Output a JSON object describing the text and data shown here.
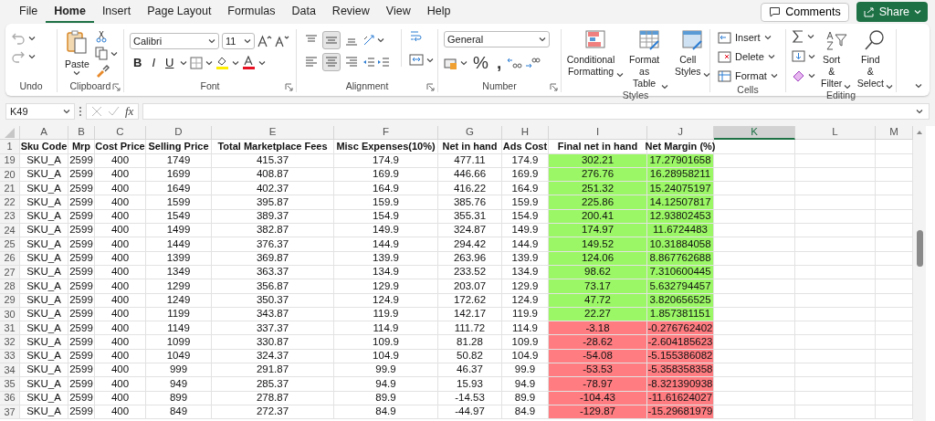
{
  "menu_tabs": [
    {
      "label": "File",
      "selected": false
    },
    {
      "label": "Home",
      "selected": true
    },
    {
      "label": "Insert",
      "selected": false
    },
    {
      "label": "Page Layout",
      "selected": false
    },
    {
      "label": "Formulas",
      "selected": false
    },
    {
      "label": "Data",
      "selected": false
    },
    {
      "label": "Review",
      "selected": false
    },
    {
      "label": "View",
      "selected": false
    },
    {
      "label": "Help",
      "selected": false
    }
  ],
  "top_buttons": {
    "comments": "Comments",
    "share": "Share"
  },
  "ribbon": {
    "groups": [
      {
        "kind": "undo",
        "label": "Undo"
      },
      {
        "kind": "clipboard",
        "label": "Clipboard",
        "launcher": true,
        "paste": "Paste"
      },
      {
        "kind": "font",
        "label": "Font",
        "launcher": true,
        "font_name": "Calibri",
        "font_size": "11",
        "style_buttons": [
          "B",
          "I",
          "U"
        ]
      },
      {
        "kind": "alignment",
        "label": "Alignment",
        "launcher": true,
        "vertical_align_buttons": [
          {
            "selected": false
          },
          {
            "selected": true
          },
          {
            "selected": false
          }
        ],
        "horizontal_align_buttons": [
          {
            "selected": false
          },
          {
            "selected": true
          },
          {
            "selected": false
          }
        ]
      },
      {
        "kind": "number",
        "label": "Number",
        "launcher": true,
        "format": "General",
        "symbol_buttons": [
          "%",
          ","
        ]
      },
      {
        "kind": "styles",
        "label": "Styles",
        "buttons": [
          "Conditional Formatting",
          "Format as Table",
          "Cell Styles"
        ]
      },
      {
        "kind": "cells",
        "label": "Cells",
        "buttons": [
          "Insert",
          "Delete",
          "Format"
        ]
      },
      {
        "kind": "editing",
        "label": "Editing",
        "buttons": [
          "Sort & Filter",
          "Find & Select"
        ]
      }
    ]
  },
  "formula_bar": {
    "name_box": "K49",
    "function_label": "fx"
  },
  "sheet": {
    "columns": [
      {
        "label": "A",
        "selected": false
      },
      {
        "label": "B",
        "selected": false
      },
      {
        "label": "C",
        "selected": false
      },
      {
        "label": "D",
        "selected": false
      },
      {
        "label": "E",
        "selected": false
      },
      {
        "label": "F",
        "selected": false
      },
      {
        "label": "G",
        "selected": false
      },
      {
        "label": "H",
        "selected": false
      },
      {
        "label": "I",
        "selected": false
      },
      {
        "label": "J",
        "selected": false
      },
      {
        "label": "K",
        "selected": true
      },
      {
        "label": "L",
        "selected": false
      },
      {
        "label": "M",
        "selected": false
      }
    ],
    "header_row": {
      "number": "1",
      "cells": [
        "Sku Code",
        "Mrp",
        "Cost Price",
        "Selling Price",
        "Total Marketplace Fees",
        "Misc Expenses(10%)",
        "Net in hand",
        "Ads Cost",
        "Final net in hand",
        "Net Margin (%)"
      ]
    },
    "rows": [
      {
        "number": "19",
        "color": "#9bf765",
        "cells": [
          "SKU_A",
          "2599",
          "400",
          "1749",
          "415.37",
          "174.9",
          "477.11",
          "174.9",
          "302.21",
          "17.27901658"
        ]
      },
      {
        "number": "20",
        "color": "#9bf765",
        "cells": [
          "SKU_A",
          "2599",
          "400",
          "1699",
          "408.87",
          "169.9",
          "446.66",
          "169.9",
          "276.76",
          "16.28958211"
        ]
      },
      {
        "number": "21",
        "color": "#9bf765",
        "cells": [
          "SKU_A",
          "2599",
          "400",
          "1649",
          "402.37",
          "164.9",
          "416.22",
          "164.9",
          "251.32",
          "15.24075197"
        ]
      },
      {
        "number": "22",
        "color": "#9bf765",
        "cells": [
          "SKU_A",
          "2599",
          "400",
          "1599",
          "395.87",
          "159.9",
          "385.76",
          "159.9",
          "225.86",
          "14.12507817"
        ]
      },
      {
        "number": "23",
        "color": "#9bf765",
        "cells": [
          "SKU_A",
          "2599",
          "400",
          "1549",
          "389.37",
          "154.9",
          "355.31",
          "154.9",
          "200.41",
          "12.93802453"
        ]
      },
      {
        "number": "24",
        "color": "#9bf765",
        "cells": [
          "SKU_A",
          "2599",
          "400",
          "1499",
          "382.87",
          "149.9",
          "324.87",
          "149.9",
          "174.97",
          "11.6724483"
        ]
      },
      {
        "number": "25",
        "color": "#9bf765",
        "cells": [
          "SKU_A",
          "2599",
          "400",
          "1449",
          "376.37",
          "144.9",
          "294.42",
          "144.9",
          "149.52",
          "10.31884058"
        ]
      },
      {
        "number": "26",
        "color": "#9bf765",
        "cells": [
          "SKU_A",
          "2599",
          "400",
          "1399",
          "369.87",
          "139.9",
          "263.96",
          "139.9",
          "124.06",
          "8.867762688"
        ]
      },
      {
        "number": "27",
        "color": "#9bf765",
        "cells": [
          "SKU_A",
          "2599",
          "400",
          "1349",
          "363.37",
          "134.9",
          "233.52",
          "134.9",
          "98.62",
          "7.310600445"
        ]
      },
      {
        "number": "28",
        "color": "#9bf765",
        "cells": [
          "SKU_A",
          "2599",
          "400",
          "1299",
          "356.87",
          "129.9",
          "203.07",
          "129.9",
          "73.17",
          "5.632794457"
        ]
      },
      {
        "number": "29",
        "color": "#9bf765",
        "cells": [
          "SKU_A",
          "2599",
          "400",
          "1249",
          "350.37",
          "124.9",
          "172.62",
          "124.9",
          "47.72",
          "3.820656525"
        ]
      },
      {
        "number": "30",
        "color": "#9bf765",
        "cells": [
          "SKU_A",
          "2599",
          "400",
          "1199",
          "343.87",
          "119.9",
          "142.17",
          "119.9",
          "22.27",
          "1.857381151"
        ]
      },
      {
        "number": "31",
        "color": "#ff7c80",
        "cells": [
          "SKU_A",
          "2599",
          "400",
          "1149",
          "337.37",
          "114.9",
          "111.72",
          "114.9",
          "-3.18",
          "-0.276762402"
        ]
      },
      {
        "number": "32",
        "color": "#ff7c80",
        "cells": [
          "SKU_A",
          "2599",
          "400",
          "1099",
          "330.87",
          "109.9",
          "81.28",
          "109.9",
          "-28.62",
          "-2.604185623"
        ]
      },
      {
        "number": "33",
        "color": "#ff7c80",
        "cells": [
          "SKU_A",
          "2599",
          "400",
          "1049",
          "324.37",
          "104.9",
          "50.82",
          "104.9",
          "-54.08",
          "-5.155386082"
        ]
      },
      {
        "number": "34",
        "color": "#ff7c80",
        "cells": [
          "SKU_A",
          "2599",
          "400",
          "999",
          "291.87",
          "99.9",
          "46.37",
          "99.9",
          "-53.53",
          "-5.358358358"
        ]
      },
      {
        "number": "35",
        "color": "#ff7c80",
        "cells": [
          "SKU_A",
          "2599",
          "400",
          "949",
          "285.37",
          "94.9",
          "15.93",
          "94.9",
          "-78.97",
          "-8.321390938"
        ]
      },
      {
        "number": "36",
        "color": "#ff7c80",
        "cells": [
          "SKU_A",
          "2599",
          "400",
          "899",
          "278.87",
          "89.9",
          "-14.53",
          "89.9",
          "-104.43",
          "-11.61624027"
        ]
      },
      {
        "number": "37",
        "color": "#ff7c80",
        "cells": [
          "SKU_A",
          "2599",
          "400",
          "849",
          "272.37",
          "84.9",
          "-44.97",
          "84.9",
          "-129.87",
          "-15.29681979"
        ]
      }
    ]
  }
}
